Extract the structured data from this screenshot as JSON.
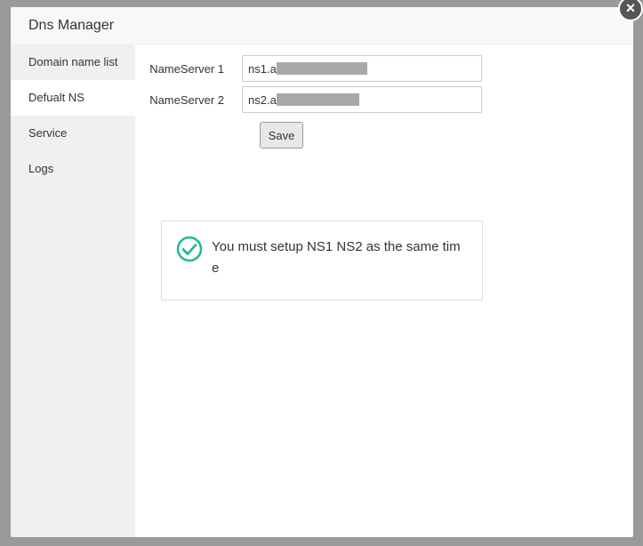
{
  "modal": {
    "title": "Dns Manager"
  },
  "sidebar": {
    "items": [
      {
        "label": "Domain name list"
      },
      {
        "label": "Defualt NS"
      },
      {
        "label": "Service"
      },
      {
        "label": "Logs"
      }
    ]
  },
  "form": {
    "ns1": {
      "label": "NameServer 1",
      "value": "ns1.a"
    },
    "ns2": {
      "label": "NameServer 2",
      "value": "ns2.a"
    },
    "save_label": "Save"
  },
  "message": {
    "text": "You must setup NS1 NS2 as the same time",
    "icon": "check-circle-icon",
    "color": "#20b99a"
  },
  "close_icon": "close-icon"
}
